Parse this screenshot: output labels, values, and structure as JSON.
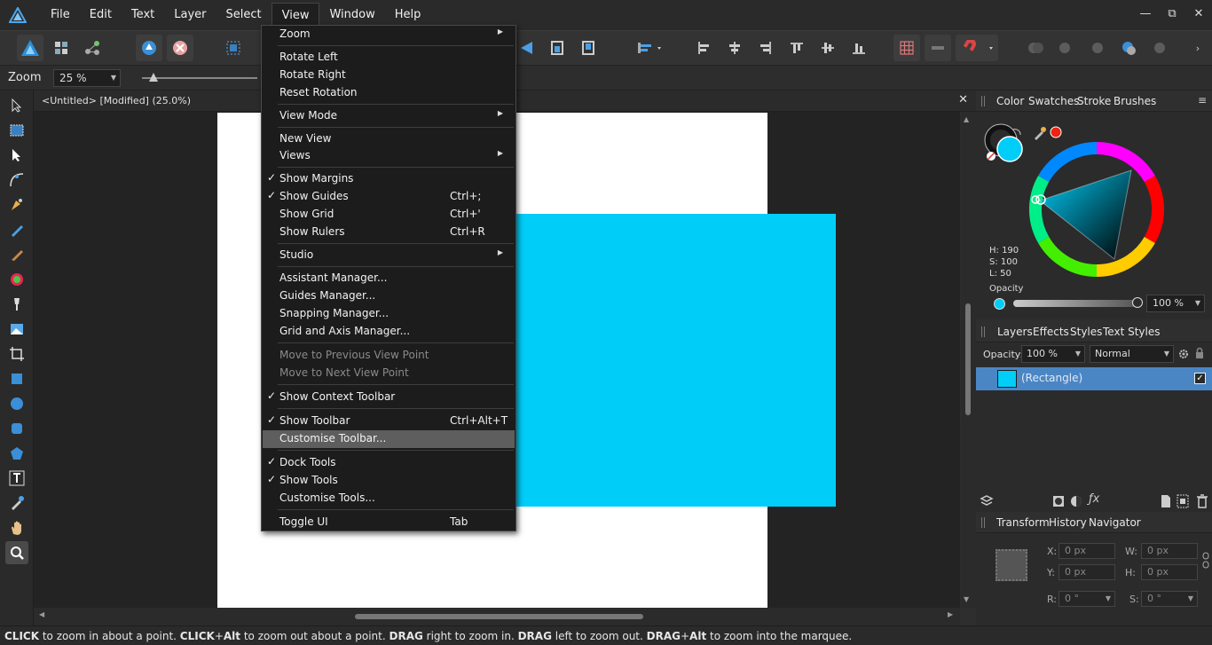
{
  "menubar": {
    "items": [
      "File",
      "Edit",
      "Text",
      "Layer",
      "Select",
      "View",
      "Window",
      "Help"
    ],
    "active": "View"
  },
  "window_controls": {
    "minimize": "—",
    "restore": "⧉",
    "close": "✕"
  },
  "context": {
    "label": "Zoom",
    "zoom_value": "25 %"
  },
  "document": {
    "title": "<Untitled> [Modified] (25.0%)",
    "close": "✕"
  },
  "view_menu": {
    "items": [
      {
        "label": "Zoom",
        "submenu": true
      },
      {
        "label": "Rotate Left"
      },
      {
        "label": "Rotate Right"
      },
      {
        "label": "Reset Rotation"
      },
      {
        "label": "View Mode",
        "submenu": true
      },
      {
        "label": "New View"
      },
      {
        "label": "Views",
        "submenu": true
      },
      {
        "label": "Show Margins",
        "checked": true
      },
      {
        "label": "Show Guides",
        "checked": true,
        "shortcut": "Ctrl+;"
      },
      {
        "label": "Show Grid",
        "shortcut": "Ctrl+'"
      },
      {
        "label": "Show Rulers",
        "shortcut": "Ctrl+R"
      },
      {
        "label": "Studio",
        "submenu": true
      },
      {
        "label": "Assistant Manager..."
      },
      {
        "label": "Guides Manager..."
      },
      {
        "label": "Snapping Manager..."
      },
      {
        "label": "Grid and Axis Manager..."
      },
      {
        "label": "Move to Previous View Point",
        "disabled": true
      },
      {
        "label": "Move to Next View Point",
        "disabled": true
      },
      {
        "label": "Show Context Toolbar",
        "checked": true
      },
      {
        "label": "Show Toolbar",
        "checked": true,
        "shortcut": "Ctrl+Alt+T"
      },
      {
        "label": "Customise Toolbar...",
        "highlighted": true
      },
      {
        "label": "Dock Tools",
        "checked": true
      },
      {
        "label": "Show Tools",
        "checked": true
      },
      {
        "label": "Customise Tools..."
      },
      {
        "label": "Toggle UI",
        "shortcut": "Tab"
      }
    ],
    "check_glyph": "✓",
    "submenu_glyph": "▶"
  },
  "color_panel": {
    "tabs": [
      "Color",
      "Swatches",
      "Stroke",
      "Brushes"
    ],
    "h": "H: 190",
    "s": "S: 100",
    "l": "L: 50",
    "opacity_label": "Opacity",
    "opacity_value": "100 %",
    "fill_color": "#00cdf8"
  },
  "layers_panel": {
    "tabs": [
      "Layers",
      "Effects",
      "Styles",
      "Text Styles"
    ],
    "opacity_label": "Opacity:",
    "opacity_value": "100 %",
    "blend_mode": "Normal",
    "layer_name": "(Rectangle)",
    "layer_visible": "✓"
  },
  "transform_panel": {
    "tabs": [
      "Transform",
      "History",
      "Navigator"
    ],
    "x_label": "X:",
    "x_value": "0 px",
    "y_label": "Y:",
    "y_value": "0 px",
    "w_label": "W:",
    "w_value": "0 px",
    "h_label": "H:",
    "h_value": "0 px",
    "r_label": "R:",
    "r_value": "0 °",
    "s_label": "S:",
    "s_value": "0 °"
  },
  "status": {
    "k1": "CLICK",
    "t1": " to zoom in about a point. ",
    "k2": "CLICK",
    "t2": "+",
    "k3": "Alt",
    "t3": " to zoom out about a point. ",
    "k4": "DRAG",
    "t4": " right to zoom in. ",
    "k5": "DRAG",
    "t5": " left to zoom out. ",
    "k6": "DRAG",
    "t6": "+",
    "k7": "Alt",
    "t7": " to zoom into the marquee."
  }
}
